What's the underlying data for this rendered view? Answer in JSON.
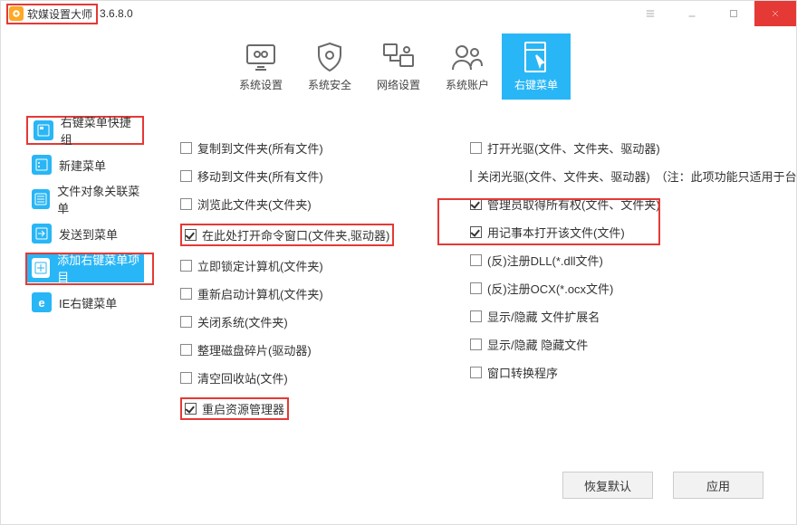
{
  "titlebar": {
    "app_name": "软媒设置大师",
    "version": "3.6.8.0"
  },
  "tabs": [
    {
      "id": "system-settings",
      "label": "系统设置"
    },
    {
      "id": "system-security",
      "label": "系统安全"
    },
    {
      "id": "network-settings",
      "label": "网络设置"
    },
    {
      "id": "system-accounts",
      "label": "系统账户"
    },
    {
      "id": "context-menu",
      "label": "右键菜单"
    }
  ],
  "active_tab": "右键菜单",
  "sidebar": {
    "items": [
      {
        "id": "quick-group",
        "label": "右键菜单快捷组"
      },
      {
        "id": "new-menu",
        "label": "新建菜单"
      },
      {
        "id": "file-assoc",
        "label": "文件对象关联菜单"
      },
      {
        "id": "sendto",
        "label": "发送到菜单"
      },
      {
        "id": "add-context",
        "label": "添加右键菜单项目"
      },
      {
        "id": "ie-context",
        "label": "IE右键菜单"
      }
    ],
    "active_id": "add-context"
  },
  "options": {
    "left": [
      {
        "label": "复制到文件夹(所有文件)",
        "checked": false
      },
      {
        "label": "移动到文件夹(所有文件)",
        "checked": false
      },
      {
        "label": "浏览此文件夹(文件夹)",
        "checked": false
      },
      {
        "label": "在此处打开命令窗口(文件夹,驱动器)",
        "checked": true,
        "highlight": true
      },
      {
        "label": "立即锁定计算机(文件夹)",
        "checked": false
      },
      {
        "label": "重新启动计算机(文件夹)",
        "checked": false
      },
      {
        "label": "关闭系统(文件夹)",
        "checked": false
      },
      {
        "label": "整理磁盘碎片(驱动器)",
        "checked": false
      },
      {
        "label": "清空回收站(文件)",
        "checked": false
      },
      {
        "label": "重启资源管理器",
        "checked": true,
        "highlight": true
      }
    ],
    "right": [
      {
        "label": "打开光驱(文件、文件夹、驱动器)",
        "checked": false
      },
      {
        "label": "关闭光驱(文件、文件夹、驱动器)",
        "note": "（注：此项功能只适用于台式机）",
        "checked": false
      },
      {
        "label": "管理员取得所有权(文件、文件夹)",
        "checked": true,
        "highlight_group": true
      },
      {
        "label": "用记事本打开该文件(文件)",
        "checked": true,
        "highlight_group": true
      },
      {
        "label": "(反)注册DLL(*.dll文件)",
        "checked": false
      },
      {
        "label": "(反)注册OCX(*.ocx文件)",
        "checked": false
      },
      {
        "label": "显示/隐藏 文件扩展名",
        "checked": false
      },
      {
        "label": "显示/隐藏 隐藏文件",
        "checked": false
      },
      {
        "label": "窗口转换程序",
        "checked": false
      }
    ]
  },
  "footer": {
    "restore_default": "恢复默认",
    "apply": "应用"
  }
}
